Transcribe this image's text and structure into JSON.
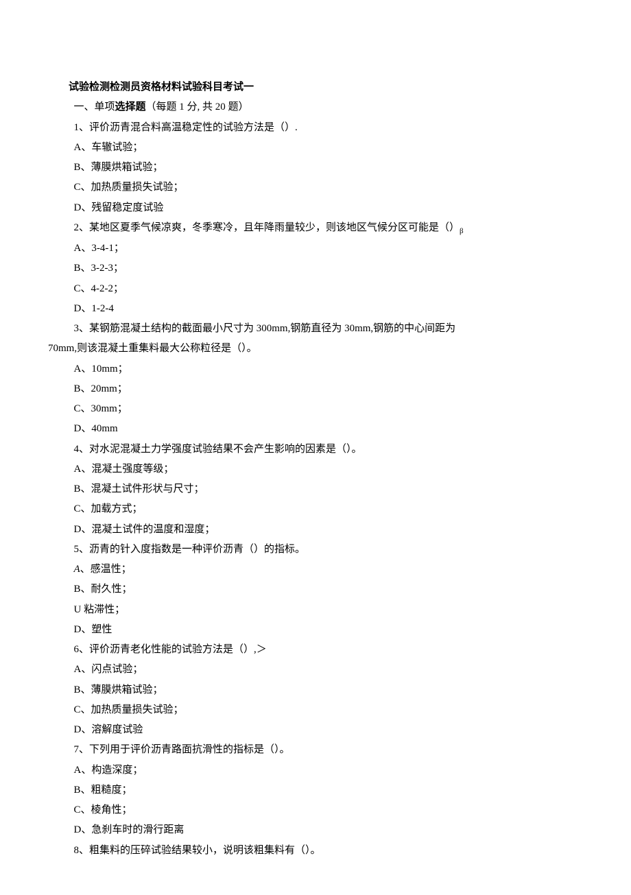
{
  "title": "试验检测检测员资格材料试验科目考试一",
  "section_line_prefix": "一、单项",
  "section_line_bold": "选择题",
  "section_line_suffix": "（每题 1 分, 共 20 题）",
  "q1": {
    "stem": "1、评价沥青混合料高温稳定性的试验方法是（）.",
    "A": "A、车辙试验；",
    "B": "B、薄膜烘箱试验；",
    "C": "C、加热质量损失试验；",
    "D": "D、残留稳定度试验"
  },
  "q2": {
    "stem_prefix": "2、某地区夏季气候凉爽，冬季寒冷，且年降雨量较少，则该地区气候分区可能是（）",
    "stem_sub": "β",
    "A": "A、3-4-1；",
    "B": "B、3-2-3；",
    "C": "C、4-2-2；",
    "D": "D、1-2-4"
  },
  "q3": {
    "line1": "3、某钢筋混凝土结构的截面最小尺寸为 300mm,钢筋直径为 30mm,钢筋的中心间距为",
    "line2": "70mm,则该混凝土重集料最大公称粒径是（）。",
    "A": "A、10mm；",
    "B": "B、20mm；",
    "C": "C、30mm；",
    "D": "D、40mm"
  },
  "q4": {
    "stem": "4、对水泥混凝土力学强度试验结果不会产生影响的因素是（）。",
    "A": "A、混凝土强度等级；",
    "B": "B、混凝土试件形状与尺寸；",
    "C": "C、加载方式；",
    "D": "D、混凝土试件的温度和湿度；"
  },
  "q5": {
    "stem": "5、沥青的针入度指数是一种评价沥青（）的指标。",
    "A_letter": "A",
    "A_text": "、感温性；",
    "B": "B、耐久性；",
    "C_letter": "U",
    "C_text": " 粘滞性；",
    "D": "D、塑性"
  },
  "q6": {
    "stem": "6、评价沥青老化性能的试验方法是（）,＞",
    "A": "A、闪点试验；",
    "B": "B、薄膜烘箱试验；",
    "C": "C、加热质量损失试验；",
    "D": "D、溶解度试验"
  },
  "q7": {
    "stem": "7、下列用于评价沥青路面抗滑性的指标是（）。",
    "A": "A、构造深度；",
    "B": "B、粗糙度；",
    "C": "C、棱角性；",
    "D": "D、急刹车时的滑行距离"
  },
  "q8": {
    "stem": "8、粗集料的压碎试验结果较小，说明该粗集料有（）。"
  }
}
